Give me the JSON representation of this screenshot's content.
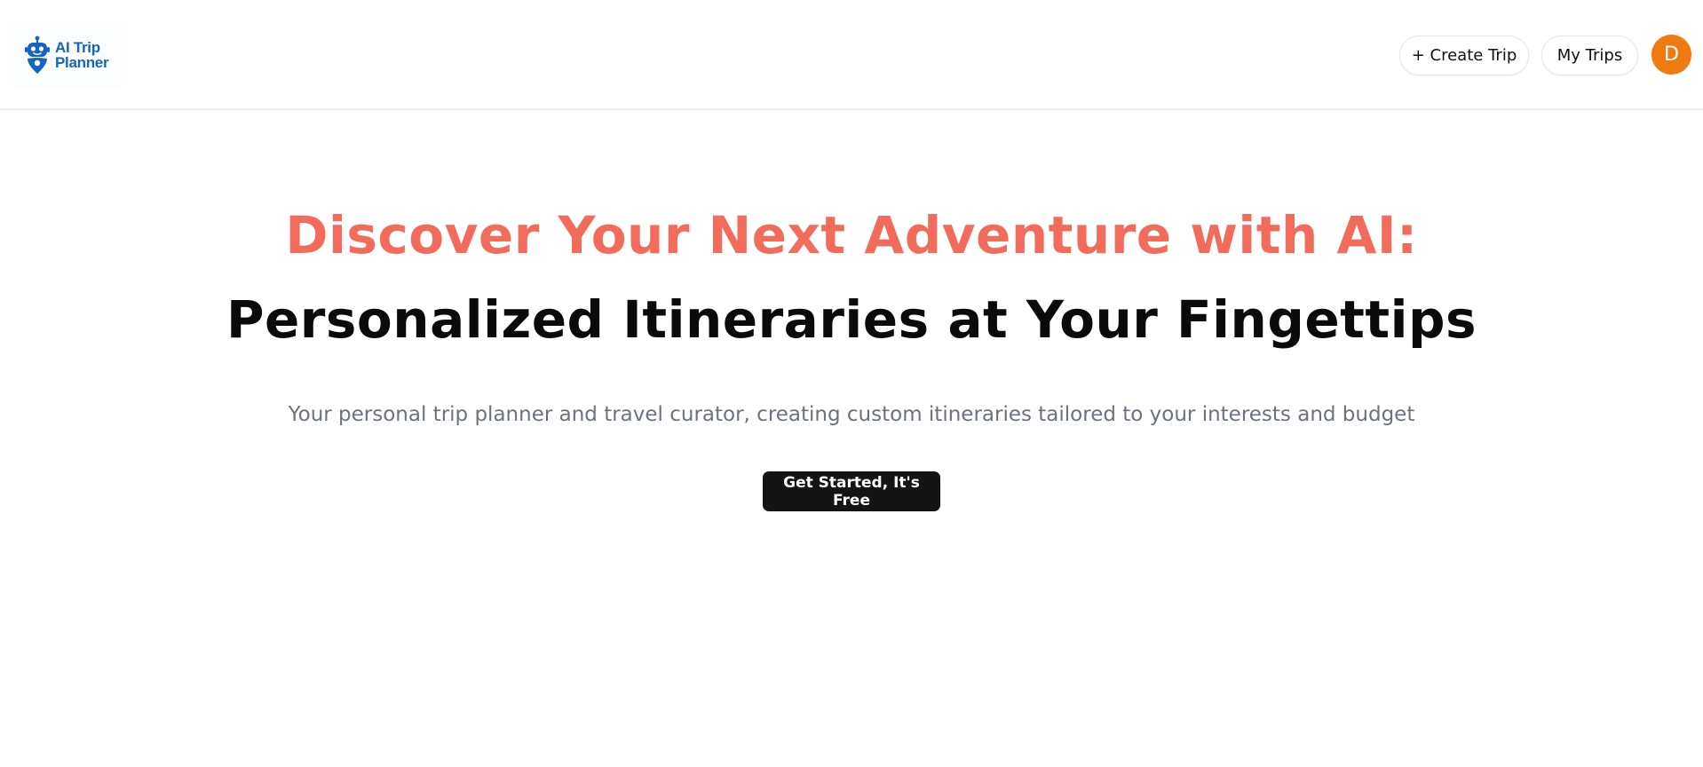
{
  "header": {
    "logo": {
      "icon": "robot-pin-icon",
      "line1": "AI Trip",
      "line2": "Planner",
      "color": "#1565c0"
    },
    "create_trip_label": "+ Create Trip",
    "my_trips_label": "My Trips",
    "avatar_initial": "D",
    "avatar_color": "#ef7a0f"
  },
  "hero": {
    "headline_1": "Discover Your Next Adventure with AI:",
    "headline_1_color": "#f26b5b",
    "headline_2": "Personalized Itineraries at Your Fingettips",
    "subtitle": "Your personal trip planner and travel curator, creating custom itineraries tailored to your interests and budget",
    "cta_label": "Get Started, It's Free"
  }
}
